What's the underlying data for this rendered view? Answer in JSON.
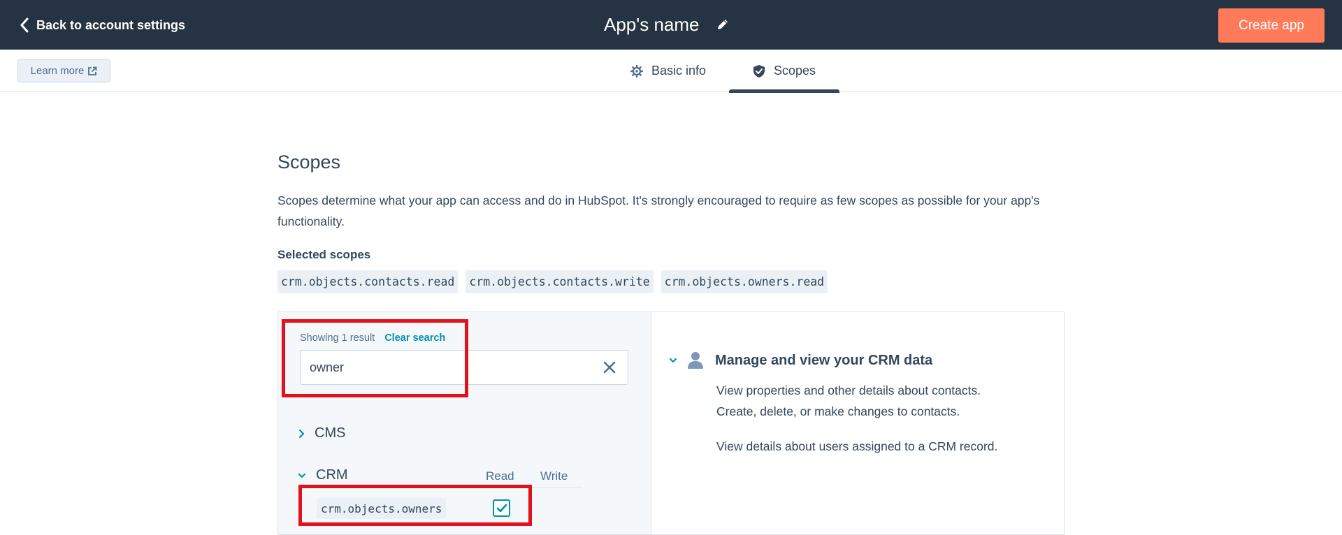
{
  "topbar": {
    "back_label": "Back to account settings",
    "app_name": "App's name",
    "create_label": "Create app",
    "accent_color": "#ff7a59",
    "background_color": "#253342"
  },
  "subnav": {
    "learn_more_label": "Learn more",
    "tabs": [
      {
        "label": "Basic info",
        "icon": "gear-icon",
        "active": false
      },
      {
        "label": "Scopes",
        "icon": "shield-check-icon",
        "active": true
      }
    ]
  },
  "main": {
    "heading": "Scopes",
    "description": "Scopes determine what your app can access and do in HubSpot. It's strongly encouraged to require as few scopes as possible for your app's functionality.",
    "selected_label": "Selected scopes",
    "selected_scopes": [
      "crm.objects.contacts.read",
      "crm.objects.contacts.write",
      "crm.objects.owners.read"
    ]
  },
  "scope_panel": {
    "showing_text": "Showing 1 result",
    "clear_search_label": "Clear search",
    "search_value": "owner",
    "categories": [
      {
        "label": "CMS",
        "expanded": false
      },
      {
        "label": "CRM",
        "expanded": true
      }
    ],
    "columns": {
      "read": "Read",
      "write": "Write"
    },
    "rows": [
      {
        "scope": "crm.objects.owners",
        "read_checked": true
      }
    ],
    "detail": {
      "title": "Manage and view your CRM data",
      "line1": "View properties and other details about contacts.",
      "line2": "Create, delete, or make changes to contacts.",
      "line3": "View details about users assigned to a CRM record."
    }
  },
  "highlight_color": "#e3111b"
}
